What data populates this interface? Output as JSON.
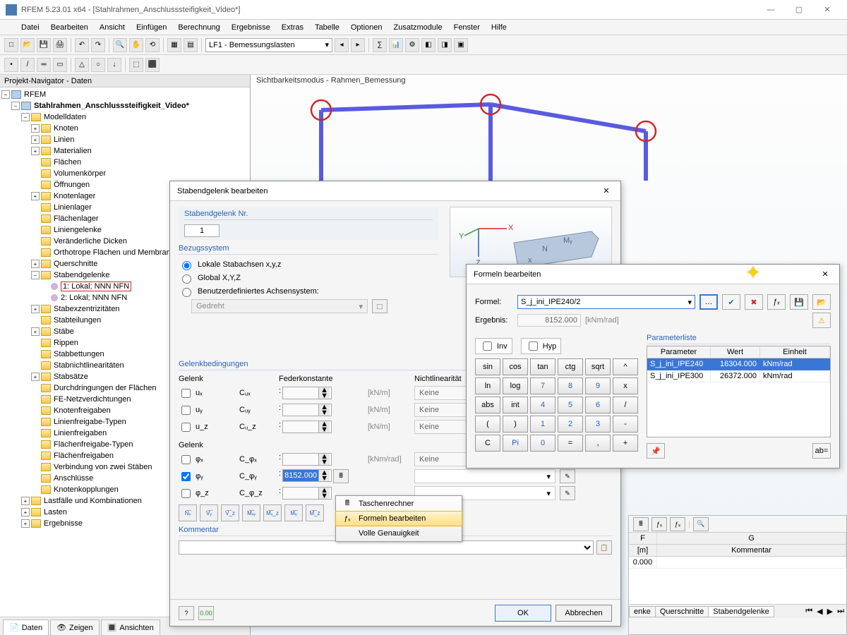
{
  "titlebar": {
    "text": "RFEM 5.23.01 x64 - [Stahlrahmen_Anschlusssteifigkeit_Video*]"
  },
  "win_controls": {
    "min": "—",
    "max": "▢",
    "close": "✕"
  },
  "menubar": [
    "Datei",
    "Bearbeiten",
    "Ansicht",
    "Einfügen",
    "Berechnung",
    "Ergebnisse",
    "Extras",
    "Tabelle",
    "Optionen",
    "Zusatzmodule",
    "Fenster",
    "Hilfe"
  ],
  "toolbar_combo": "LF1 - Bemessungslasten",
  "navigator": {
    "title": "Projekt-Navigator - Daten",
    "root": "RFEM",
    "model": "Stahlrahmen_Anschlusssteifigkeit_Video*",
    "modelldaten": "Modelldaten",
    "items_top": [
      "Knoten",
      "Linien",
      "Materialien",
      "Flächen",
      "Volumenkörper",
      "Öffnungen",
      "Knotenlager",
      "Linienlager",
      "Flächenlager",
      "Liniengelenke",
      "Veränderliche Dicken",
      "Orthotrope Flächen und Membranen",
      "Querschnitte"
    ],
    "stabend": "Stabendgelenke",
    "stabend_children": [
      "1: Lokal; NNN NFN",
      "2: Lokal; NNN NFN"
    ],
    "items_bottom": [
      "Stabexzentrizitäten",
      "Stabteilungen",
      "Stäbe",
      "Rippen",
      "Stabbettungen",
      "Stabnichtlinearitäten",
      "Stabsätze",
      "Durchdringungen der Flächen",
      "FE-Netzverdichtungen",
      "Knotenfreigaben",
      "Linienfreigabe-Typen",
      "Linienfreigaben",
      "Flächenfreigabe-Typen",
      "Flächenfreigaben",
      "Verbindung von zwei Stäben",
      "Anschlüsse",
      "Knotenkopplungen"
    ],
    "groups_bottom": [
      "Lastfälle und Kombinationen",
      "Lasten",
      "Ergebnisse"
    ],
    "tabs": [
      "Daten",
      "Zeigen",
      "Ansichten"
    ]
  },
  "viewport": {
    "mode": "Sichtbarkeitsmodus - Rahmen_Bemessung"
  },
  "dialog1": {
    "title": "Stabendgelenk bearbeiten",
    "sec_nr": "Stabendgelenk Nr.",
    "nr": "1",
    "sec_bezug": "Bezugssystem",
    "opt1": "Lokale Stabachsen x,y,z",
    "opt2": "Global X,Y,Z",
    "opt3": "Benutzerdefiniertes Achsensystem:",
    "rot_combo": "Gedreht",
    "sec_gelenk": "Gelenkbedingungen",
    "col_gelenk": "Gelenk",
    "col_feder": "Federkonstante",
    "col_nl": "Nichtlinearität",
    "rows_u": [
      {
        "name": "uₓ",
        "c": "Cᵤₓ",
        "unit": "[kN/m]",
        "nl": "Keine"
      },
      {
        "name": "uᵧ",
        "c": "Cᵤᵧ",
        "unit": "[kN/m]",
        "nl": "Keine"
      },
      {
        "name": "u_z",
        "c": "Cᵤ_z",
        "unit": "[kN/m]",
        "nl": "Keine"
      }
    ],
    "col_gelenk2": "Gelenk",
    "rows_phi": [
      {
        "name": "φₓ",
        "c": "C_φₓ",
        "val": "",
        "unit": "[kNm/rad]",
        "nl": "Keine"
      },
      {
        "name": "φᵧ",
        "c": "C_φᵧ",
        "val": "8152.000",
        "unit": "",
        "nl": ""
      },
      {
        "name": "φ_z",
        "c": "C_φ_z",
        "val": "",
        "unit": "",
        "nl": ""
      }
    ],
    "btnrow": [
      "N͞ₓ",
      "V͞ᵧ",
      "V͞_z",
      "M͞ₓᵧ",
      "M͞ₓ_z",
      "M͞ᵧ",
      "M͞_z"
    ],
    "sec_comment": "Kommentar",
    "ok": "OK",
    "cancel": "Abbrechen"
  },
  "ctx": {
    "calc": "Taschenrechner",
    "formula": "Formeln bearbeiten",
    "precision": "Volle Genauigkeit",
    "icon_calc": "🖩",
    "icon_fx": "ƒₓ"
  },
  "dialog2": {
    "title": "Formeln bearbeiten",
    "lbl_formula": "Formel:",
    "formula": "S_j_ini_IPE240/2",
    "lbl_result": "Ergebnis:",
    "result": "8152.000",
    "result_unit": "[kNm/rad]",
    "chk_inv": "Inv",
    "chk_hyp": "Hyp",
    "pad": [
      [
        "sin",
        "cos",
        "tan",
        "ctg",
        "sqrt",
        "^"
      ],
      [
        "ln",
        "log",
        "7",
        "8",
        "9",
        "x"
      ],
      [
        "abs",
        "int",
        "4",
        "5",
        "6",
        "/"
      ],
      [
        "(",
        ")",
        "1",
        "2",
        "3",
        "-"
      ],
      [
        "C",
        "Pi",
        "0",
        "=",
        ",",
        "+"
      ]
    ],
    "param_title": "Parameterliste",
    "param_head": [
      "Parameter",
      "Wert",
      "Einheit"
    ],
    "params": [
      {
        "name": "S_j_ini_IPE240",
        "val": "16304.000",
        "unit": "kNm/rad"
      },
      {
        "name": "S_j_ini_IPE300",
        "val": "26372.000",
        "unit": "kNm/rad"
      }
    ]
  },
  "sheet": {
    "cols": [
      "F",
      "G"
    ],
    "head2": [
      "[m]",
      "Kommentar"
    ],
    "row1": [
      "0.000",
      ""
    ],
    "tabs": [
      "enke",
      "Querschnitte",
      "Stabendgelenke"
    ]
  },
  "bottom_tabs_center": [
    "Sichtbarkeitsmodus"
  ]
}
